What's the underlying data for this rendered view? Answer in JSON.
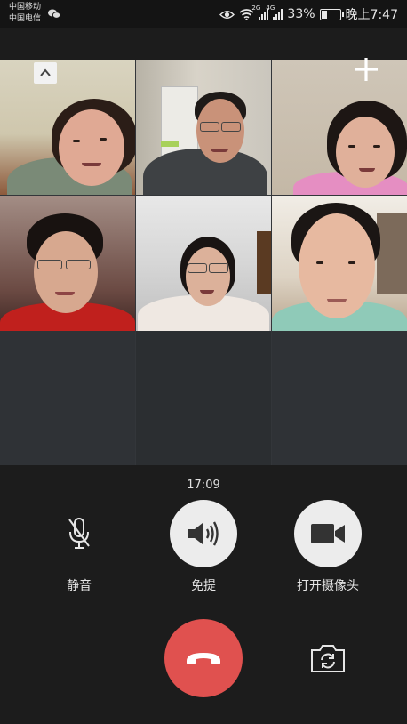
{
  "status_bar": {
    "carrier_1": "中国移动",
    "carrier_2": "中国电信",
    "net_1": "2G",
    "net_2": "4G",
    "battery_percent_text": "33%",
    "battery_level": 0.33,
    "time": "晚上7:47"
  },
  "call": {
    "duration": "17:09"
  },
  "controls": {
    "mute_label": "静音",
    "speaker_label": "免提",
    "camera_label": "打开摄像头"
  },
  "icons": {
    "collapse": "chevron-up-icon",
    "add": "plus-icon",
    "mute": "microphone-muted-icon",
    "speaker": "speaker-icon",
    "camera": "video-camera-icon",
    "hangup": "phone-hangup-icon",
    "switch_camera": "switch-camera-icon"
  },
  "colors": {
    "hangup": "#e0514f",
    "background": "#1c1c1c",
    "grid_empty": "#33363a"
  }
}
